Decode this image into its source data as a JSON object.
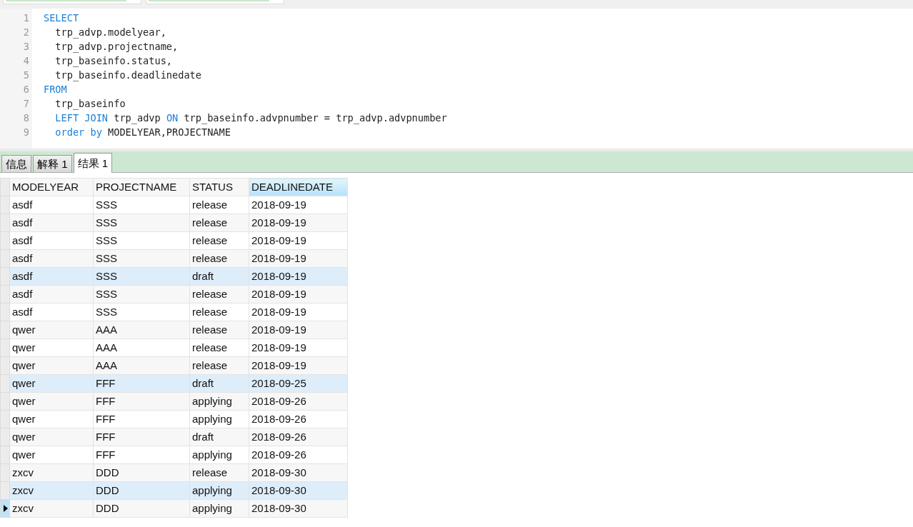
{
  "editor": {
    "lines": [
      {
        "number": "1",
        "indented": false,
        "tokens": [
          {
            "kind": "keyword",
            "text": "SELECT"
          }
        ]
      },
      {
        "number": "2",
        "indented": true,
        "tokens": [
          {
            "kind": "plain",
            "text": "trp_advp.modelyear,"
          }
        ]
      },
      {
        "number": "3",
        "indented": true,
        "tokens": [
          {
            "kind": "plain",
            "text": "trp_advp.projectname,"
          }
        ]
      },
      {
        "number": "4",
        "indented": true,
        "tokens": [
          {
            "kind": "plain",
            "text": "trp_baseinfo.status,"
          }
        ]
      },
      {
        "number": "5",
        "indented": true,
        "tokens": [
          {
            "kind": "plain",
            "text": "trp_baseinfo.deadlinedate"
          }
        ]
      },
      {
        "number": "6",
        "indented": false,
        "tokens": [
          {
            "kind": "keyword",
            "text": "FROM"
          }
        ]
      },
      {
        "number": "7",
        "indented": true,
        "tokens": [
          {
            "kind": "plain",
            "text": "trp_baseinfo"
          }
        ]
      },
      {
        "number": "8",
        "indented": true,
        "tokens": [
          {
            "kind": "keyword",
            "text": "LEFT JOIN"
          },
          {
            "kind": "plain",
            "text": " trp_advp "
          },
          {
            "kind": "keyword",
            "text": "ON"
          },
          {
            "kind": "plain",
            "text": " trp_baseinfo.advpnumber = trp_advp.advpnumber"
          }
        ]
      },
      {
        "number": "9",
        "indented": true,
        "tokens": [
          {
            "kind": "keyword",
            "text": "order by"
          },
          {
            "kind": "plain",
            "text": " MODELYEAR,PROJECTNAME"
          }
        ]
      }
    ]
  },
  "tabs": [
    {
      "label": "信息",
      "selected": false
    },
    {
      "label": "解释 1",
      "selected": false
    },
    {
      "label": "结果 1",
      "selected": true
    }
  ],
  "table": {
    "columns": [
      {
        "label": "MODELYEAR",
        "selected": false
      },
      {
        "label": "PROJECTNAME",
        "selected": false
      },
      {
        "label": "STATUS",
        "selected": false
      },
      {
        "label": "DEADLINEDATE",
        "selected": true
      }
    ],
    "rows": [
      {
        "cells": [
          "asdf",
          "SSS",
          "release",
          "2018-09-19"
        ],
        "highlighted": false,
        "current": false
      },
      {
        "cells": [
          "asdf",
          "SSS",
          "release",
          "2018-09-19"
        ],
        "highlighted": false,
        "current": false
      },
      {
        "cells": [
          "asdf",
          "SSS",
          "release",
          "2018-09-19"
        ],
        "highlighted": false,
        "current": false
      },
      {
        "cells": [
          "asdf",
          "SSS",
          "release",
          "2018-09-19"
        ],
        "highlighted": false,
        "current": false
      },
      {
        "cells": [
          "asdf",
          "SSS",
          "draft",
          "2018-09-19"
        ],
        "highlighted": true,
        "current": false
      },
      {
        "cells": [
          "asdf",
          "SSS",
          "release",
          "2018-09-19"
        ],
        "highlighted": false,
        "current": false
      },
      {
        "cells": [
          "asdf",
          "SSS",
          "release",
          "2018-09-19"
        ],
        "highlighted": false,
        "current": false
      },
      {
        "cells": [
          "qwer",
          "AAA",
          "release",
          "2018-09-19"
        ],
        "highlighted": false,
        "current": false
      },
      {
        "cells": [
          "qwer",
          "AAA",
          "release",
          "2018-09-19"
        ],
        "highlighted": false,
        "current": false
      },
      {
        "cells": [
          "qwer",
          "AAA",
          "release",
          "2018-09-19"
        ],
        "highlighted": false,
        "current": false
      },
      {
        "cells": [
          "qwer",
          "FFF",
          "draft",
          "2018-09-25"
        ],
        "highlighted": true,
        "current": false
      },
      {
        "cells": [
          "qwer",
          "FFF",
          "applying",
          "2018-09-26"
        ],
        "highlighted": false,
        "current": false
      },
      {
        "cells": [
          "qwer",
          "FFF",
          "applying",
          "2018-09-26"
        ],
        "highlighted": false,
        "current": false
      },
      {
        "cells": [
          "qwer",
          "FFF",
          "draft",
          "2018-09-26"
        ],
        "highlighted": false,
        "current": false
      },
      {
        "cells": [
          "qwer",
          "FFF",
          "applying",
          "2018-09-26"
        ],
        "highlighted": false,
        "current": false
      },
      {
        "cells": [
          "zxcv",
          "DDD",
          "release",
          "2018-09-30"
        ],
        "highlighted": false,
        "current": false
      },
      {
        "cells": [
          "zxcv",
          "DDD",
          "applying",
          "2018-09-30"
        ],
        "highlighted": true,
        "current": false
      },
      {
        "cells": [
          "zxcv",
          "DDD",
          "applying",
          "2018-09-30"
        ],
        "highlighted": false,
        "current": true
      }
    ]
  }
}
